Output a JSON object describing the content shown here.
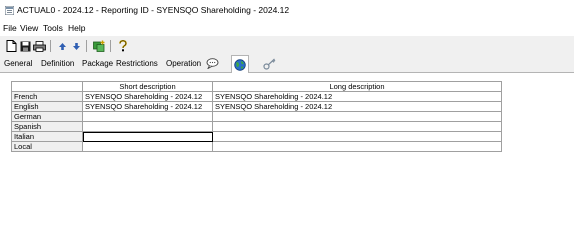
{
  "window": {
    "title": "ACTUAL0 - 2024.12 - Reporting ID - SYENSQO Shareholding - 2024.12"
  },
  "menu": [
    "File",
    "View",
    "Tools",
    "Help"
  ],
  "toolbar": {
    "icons": [
      "new-document-icon",
      "save-icon",
      "print-icon",
      "up-arrow-icon",
      "down-arrow-icon",
      "add-item-icon",
      "help-icon"
    ]
  },
  "tabs": {
    "labels": [
      "General",
      "Definition",
      "Package",
      "Restrictions",
      "Operation"
    ],
    "icon_tabs": [
      "comment-icon",
      "globe-icon",
      "key-icon"
    ],
    "active": "globe-icon"
  },
  "table": {
    "columns": [
      "",
      "Short description",
      "Long description"
    ],
    "rows": [
      {
        "language": "French",
        "short": "SYENSQO Shareholding - 2024.12",
        "long": "SYENSQO Shareholding - 2024.12"
      },
      {
        "language": "English",
        "short": "SYENSQO Shareholding - 2024.12",
        "long": "SYENSQO Shareholding - 2024.12"
      },
      {
        "language": "German",
        "short": "",
        "long": ""
      },
      {
        "language": "Spanish",
        "short": "",
        "long": ""
      },
      {
        "language": "Italian",
        "short": "",
        "long": ""
      },
      {
        "language": "Local",
        "short": "",
        "long": ""
      }
    ],
    "focused_cell": "Italian / Short description"
  },
  "colors": {
    "background": "#f0f0f0",
    "content": "#ffffff",
    "grid_line": "#a0a0a0"
  }
}
